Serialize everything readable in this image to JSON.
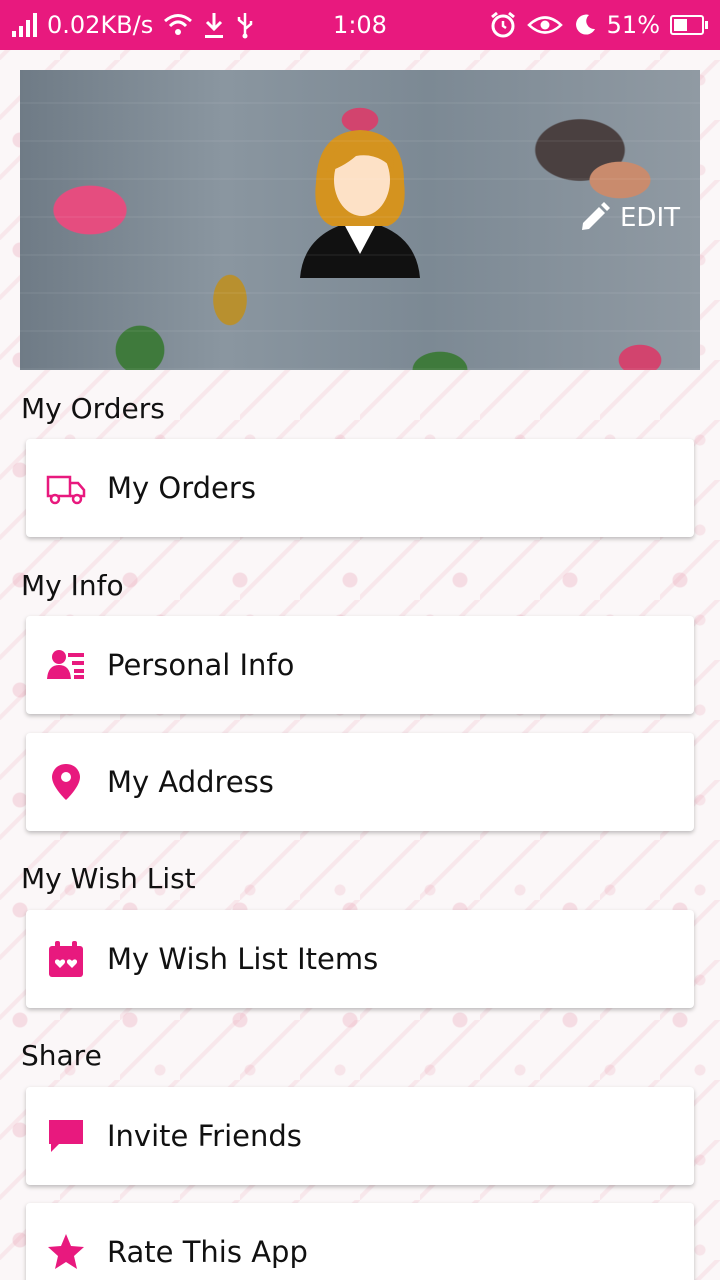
{
  "status_bar": {
    "speed": "0.02KB/s",
    "time": "1:08",
    "battery": "51%",
    "battery_level": 0.51,
    "icons": [
      "signal-icon",
      "wifi-icon",
      "download-icon",
      "usb-icon",
      "alarm-icon",
      "eye-icon",
      "moon-icon",
      "battery-icon"
    ]
  },
  "header": {
    "edit_label": "EDIT"
  },
  "sections": {
    "orders": {
      "title": "My Orders",
      "items": [
        {
          "label": "My Orders",
          "icon": "truck-icon"
        }
      ]
    },
    "info": {
      "title": "My Info",
      "items": [
        {
          "label": "Personal Info",
          "icon": "personal-info-icon"
        },
        {
          "label": "My Address",
          "icon": "location-pin-icon"
        }
      ]
    },
    "wishlist": {
      "title": "My Wish List",
      "items": [
        {
          "label": "My Wish List Items",
          "icon": "wishlist-calendar-icon"
        }
      ]
    },
    "share": {
      "title": "Share",
      "items": [
        {
          "label": "Invite Friends",
          "icon": "chat-bubble-icon"
        },
        {
          "label": "Rate This App",
          "icon": "star-icon"
        }
      ]
    }
  },
  "colors": {
    "accent": "#e8197e",
    "card_bg": "#ffffff",
    "text": "#111111"
  }
}
